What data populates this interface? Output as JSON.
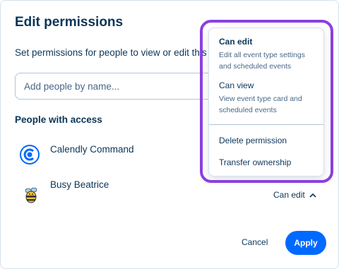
{
  "dialog": {
    "title": "Edit permissions",
    "description": "Set permissions for people to view or edit this event type",
    "search": {
      "placeholder": "Add people by name..."
    },
    "section_title": "People with access",
    "people": [
      {
        "name": "Calendly Command",
        "avatar_icon": "calendly-logo-icon"
      },
      {
        "name": "Busy Beatrice",
        "avatar_icon": "bee-icon",
        "role": "Can edit"
      }
    ],
    "cancel_label": "Cancel",
    "apply_label": "Apply"
  },
  "dropdown": {
    "options": [
      {
        "title": "Can edit",
        "description": "Edit all event type settings and scheduled events",
        "selected": true
      },
      {
        "title": "Can view",
        "description": "View event type card and scheduled events",
        "selected": false
      }
    ],
    "actions": [
      "Delete permission",
      "Transfer ownership"
    ]
  },
  "colors": {
    "text_primary": "#0b3558",
    "text_secondary": "#476788",
    "apply_button": "#0069ff",
    "highlight_outline": "#8b3fe0"
  }
}
